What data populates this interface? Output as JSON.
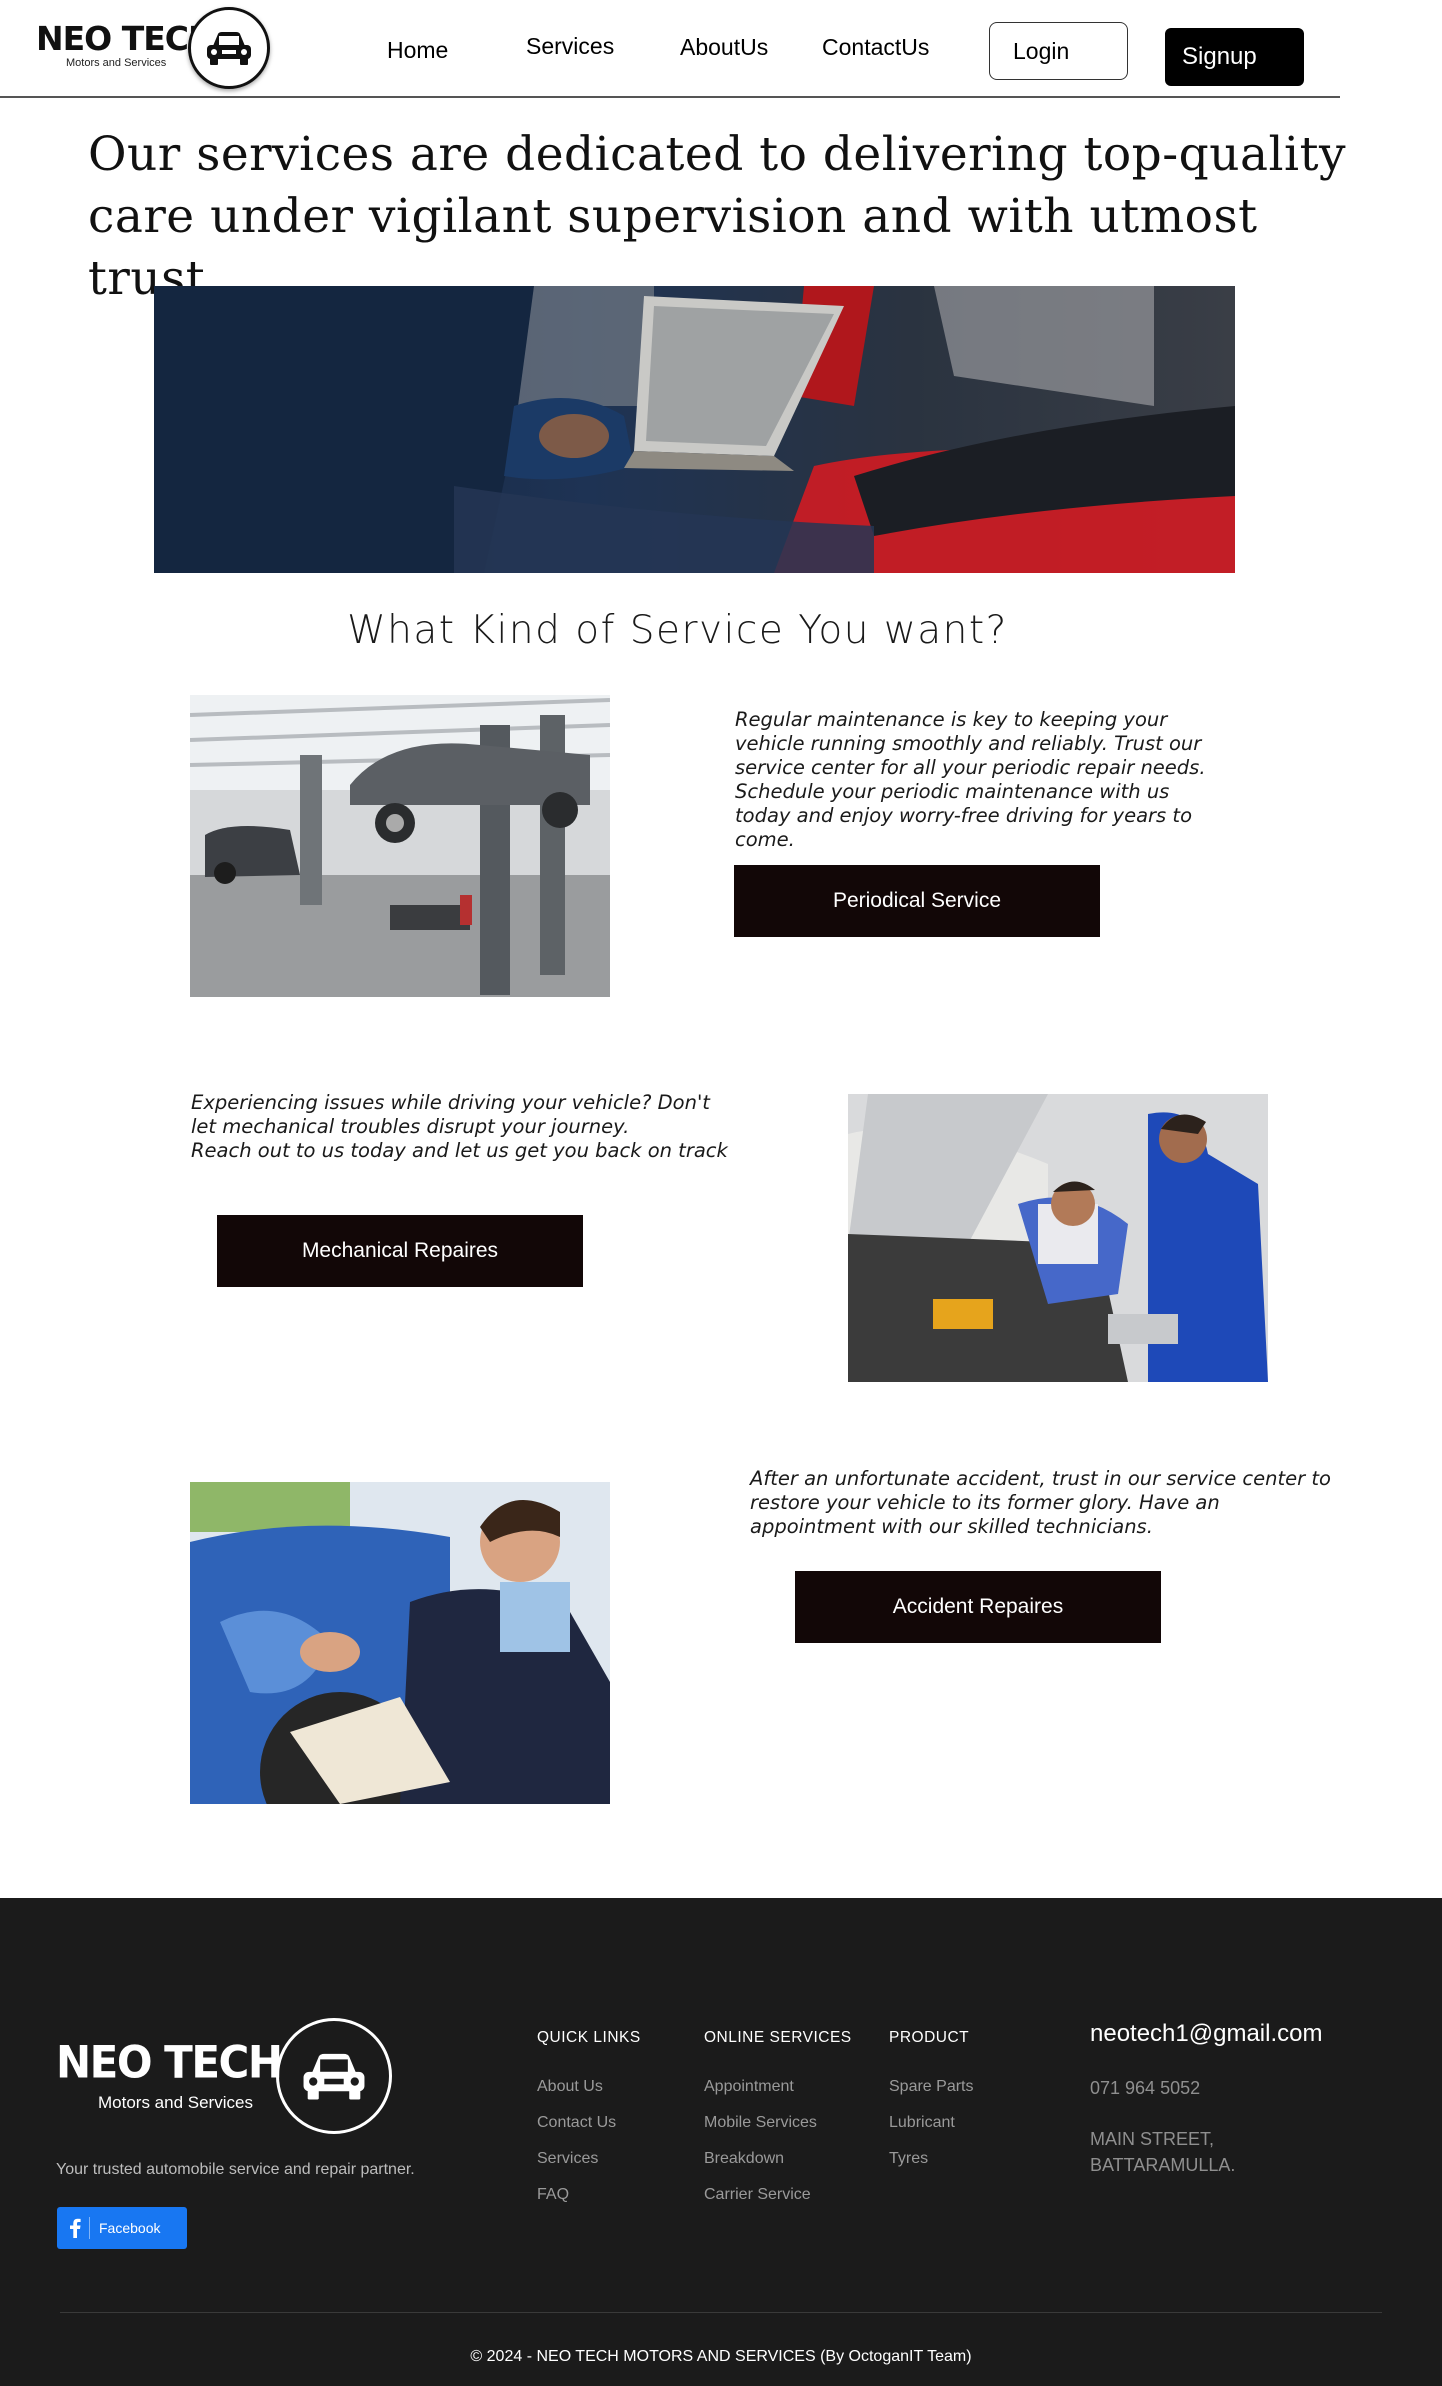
{
  "header": {
    "logo_text": "NEO TECH",
    "logo_subtext": "Motors and Services",
    "nav": {
      "home": "Home",
      "services": "Services",
      "about": "AboutUs",
      "contact": "ContactUs"
    },
    "login_label": "Login",
    "signup_label": "Signup"
  },
  "hero": {
    "title": "Our services are dedicated to delivering top-quality care under vigilant supervision and with utmost trust."
  },
  "section": {
    "title": "What Kind of Service You want?"
  },
  "services": [
    {
      "description": "Regular maintenance is key to keeping your vehicle running smoothly and reliably. Trust our service center for all your periodic repair needs.\nSchedule your periodic maintenance with us today and enjoy worry-free driving for years to come.",
      "button_label": "Periodical Service"
    },
    {
      "description": "Experiencing issues while driving your vehicle? Don't let mechanical troubles disrupt your journey.\nReach out to us today and let us get you back on track",
      "button_label": "Mechanical Repaires"
    },
    {
      "description": "After an unfortunate accident, trust in our service center to restore your vehicle to its former glory. Have an appointment with our skilled technicians.",
      "button_label": "Accident Repaires"
    }
  ],
  "footer": {
    "logo_text": "NEO TECH",
    "logo_subtext": "Motors and Services",
    "tagline": "Your trusted automobile service and repair partner.",
    "facebook_label": "Facebook",
    "quick_links": {
      "heading": "QUICK LINKS",
      "items": [
        "About Us",
        "Contact Us",
        "Services",
        "FAQ"
      ]
    },
    "online_services": {
      "heading": "ONLINE SERVICES",
      "items": [
        "Appointment",
        "Mobile Services",
        "Breakdown",
        "Carrier Service"
      ]
    },
    "product": {
      "heading": "PRODUCT",
      "items": [
        "Spare Parts",
        "Lubricant",
        "Tyres"
      ]
    },
    "contact": {
      "email": "neotech1@gmail.com",
      "phone": "071 964 5052",
      "address": "MAIN STREET,\nBATTARAMULLA."
    },
    "copyright": "© 2024 - NEO TECH MOTORS AND SERVICES (By OctoganIT Team)"
  },
  "colors": {
    "service_button": "#120707",
    "footer_bg": "#1b1b1b",
    "facebook": "#1877f2",
    "signup_bg": "#000000"
  }
}
